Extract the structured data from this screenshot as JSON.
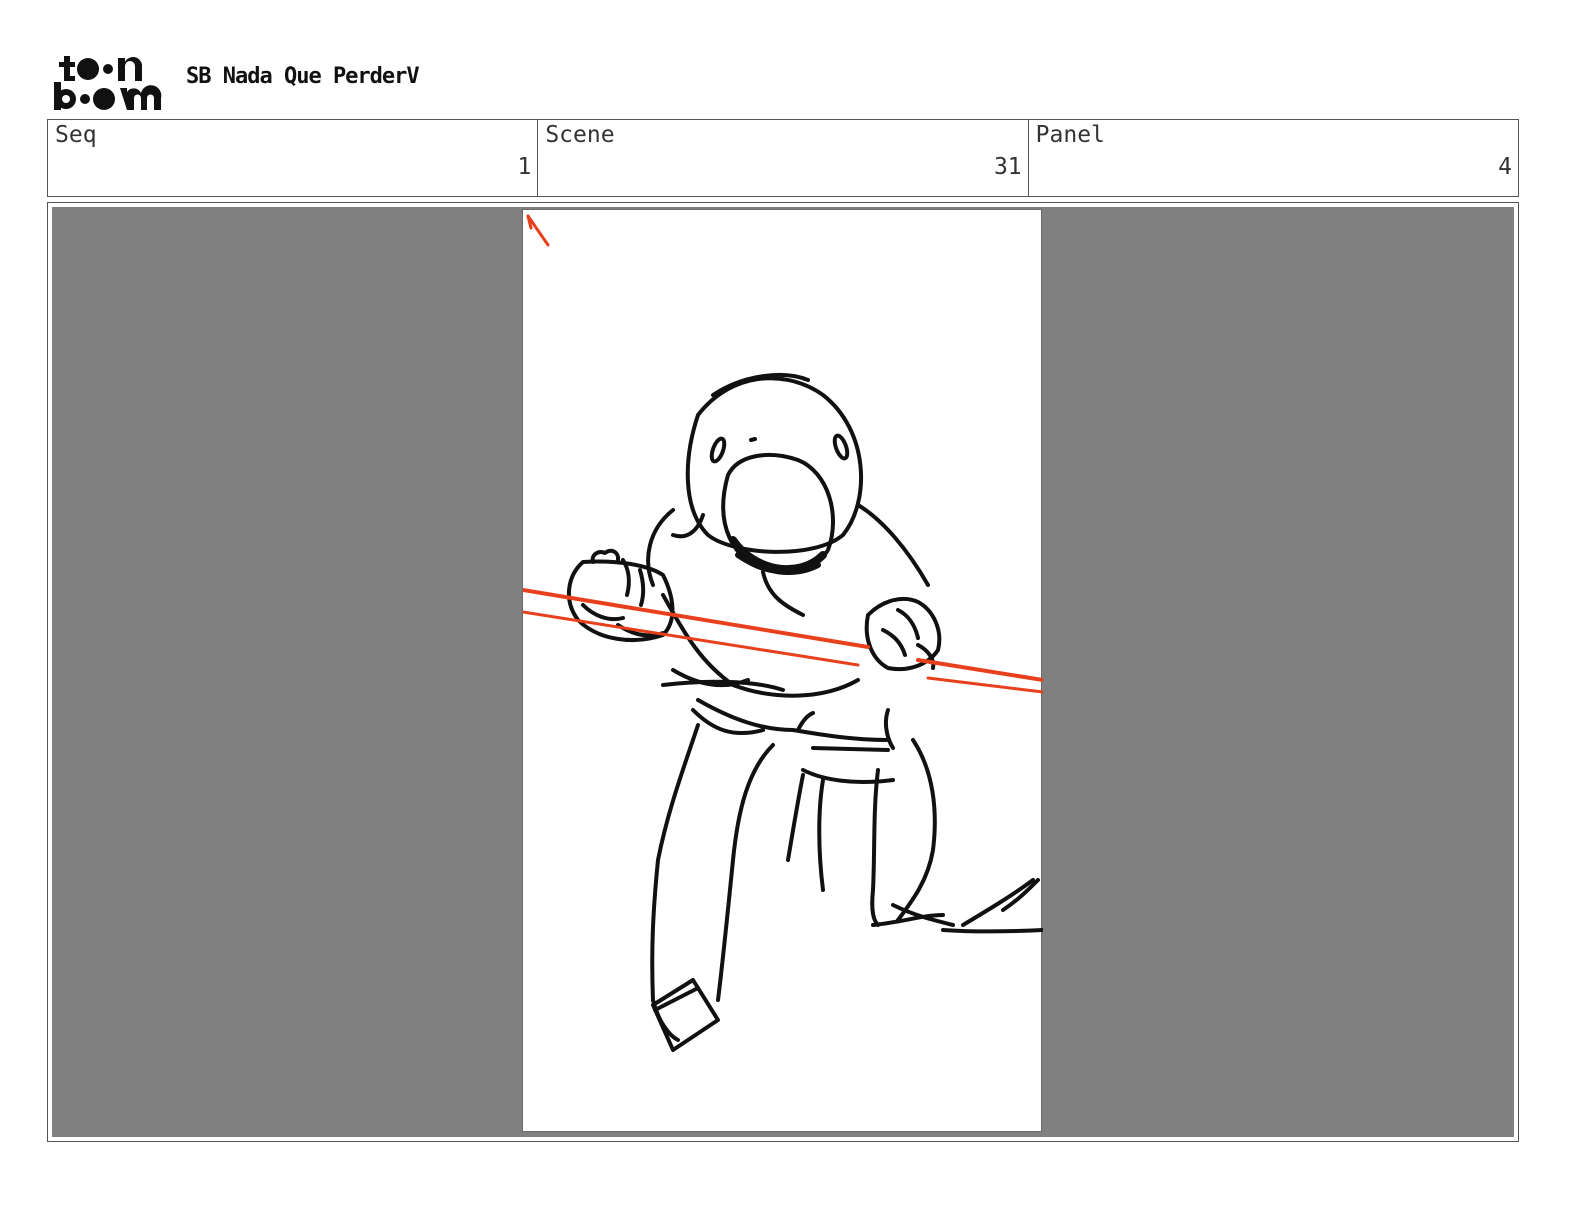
{
  "header": {
    "logo_text": "toon boom",
    "title": "SB Nada Que PerderV"
  },
  "info": {
    "seq_label": "Seq",
    "seq_value": "1",
    "scene_label": "Scene",
    "scene_value": "31",
    "panel_label": "Panel",
    "panel_value": "4"
  },
  "colors": {
    "background": "#808080",
    "sketch_line": "#111111",
    "laser": "#e8401c"
  },
  "panel": {
    "drawing_subject": "sketch-character-holding-laser"
  }
}
